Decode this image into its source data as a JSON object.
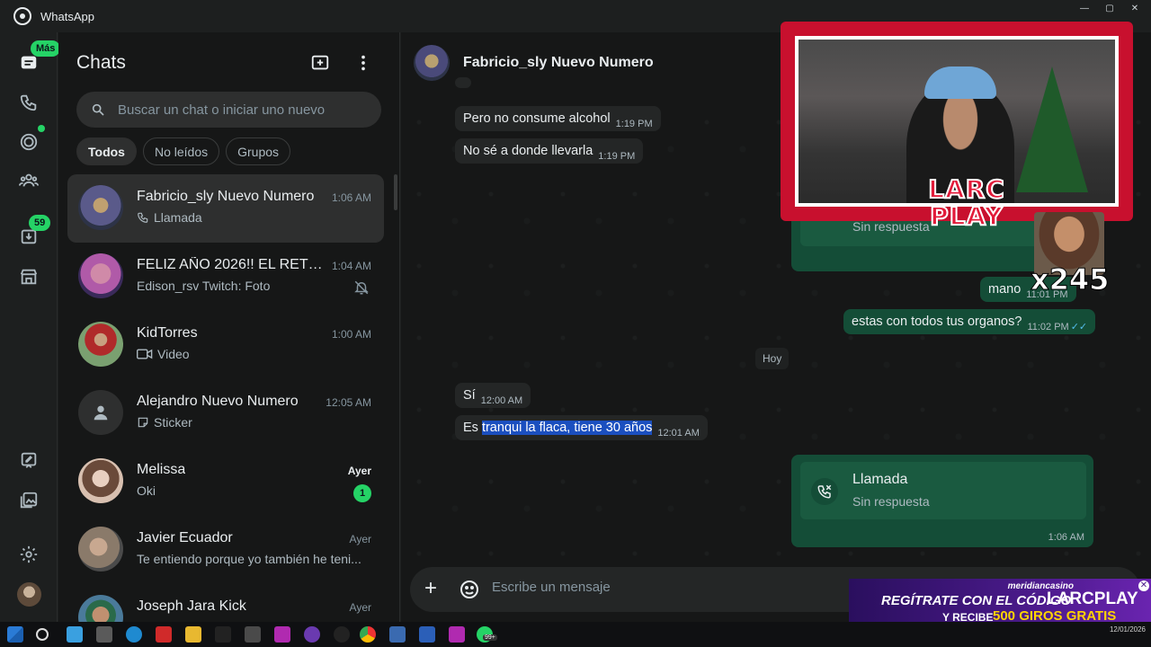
{
  "window": {
    "title": "WhatsApp"
  },
  "rail": {
    "chats_badge": "Más",
    "archive_badge": "59"
  },
  "list": {
    "title": "Chats",
    "search_placeholder": "Buscar un chat o iniciar uno nuevo",
    "filters": [
      "Todos",
      "No leídos",
      "Grupos"
    ],
    "chats": [
      {
        "name": "Fabricio_sly Nuevo Numero",
        "time": "1:06 AM",
        "preview": "Llamada",
        "preview_icon": "phone-icon",
        "color": "#6b6b8a"
      },
      {
        "name": "FELIZ AÑO 2026!! EL RETIR...",
        "time": "1:04 AM",
        "preview": "Edison_rsv Twitch:  Foto",
        "preview_icon": "photo-icon",
        "color": "#b05aa8"
      },
      {
        "name": "KidTorres",
        "time": "1:00 AM",
        "preview": "Video",
        "preview_icon": "video-icon",
        "color": "#7aa070"
      },
      {
        "name": "Alejandro Nuevo Numero",
        "time": "12:05 AM",
        "preview": "Sticker",
        "preview_icon": "sticker-icon",
        "color": "#2e2f2f"
      },
      {
        "name": "Melissa",
        "time": "Ayer",
        "preview": "Oki",
        "unread": "1",
        "color": "#d8c0b0"
      },
      {
        "name": "Javier Ecuador",
        "time": "Ayer",
        "preview": "Te entiendo porque yo también he teni...",
        "color": "#8a7a6a"
      },
      {
        "name": "Joseph Jara Kick",
        "time": "Ayer",
        "preview": "",
        "color": "#4a7a9a"
      }
    ]
  },
  "conversation": {
    "contact": "Fabricio_sly Nuevo Numero",
    "messages": [
      {
        "text": "Pero no consume alcohol",
        "time": "1:19 PM",
        "dir": "in"
      },
      {
        "text": "No sé a donde llevarla",
        "time": "1:19 PM",
        "dir": "in"
      },
      {
        "text": "mano",
        "time": "11:01 PM",
        "dir": "out"
      },
      {
        "text": "estas con todos tus organos?",
        "time": "11:02 PM",
        "dir": "out"
      },
      {
        "text": "Sí",
        "time": "12:00 AM",
        "dir": "in"
      },
      {
        "text_prefix": "Es ",
        "text_highlight": "tranqui la flaca, tiene 30 años",
        "time": "12:01 AM",
        "dir": "in"
      }
    ],
    "day_divider": "Hoy",
    "prev_call": {
      "subtitle": "Sin respuesta"
    },
    "call": {
      "title": "Llamada",
      "subtitle": "Sin respuesta",
      "time": "1:06 AM"
    },
    "composer_placeholder": "Escribe un mensaje"
  },
  "overlay": {
    "logo_line1": "LARC",
    "logo_line2": "PLAY",
    "counter": "x245",
    "ad_brand": "meridiancasino",
    "ad_line1": "REGÍTRATE CON EL CÓDIGO",
    "ad_code": "LARCPLAY",
    "ad_line2a": "Y RECIBE",
    "ad_line2b": "500 GIROS GRATIS"
  },
  "taskbar": {
    "badge": "99+",
    "date": "12/01/2026"
  }
}
